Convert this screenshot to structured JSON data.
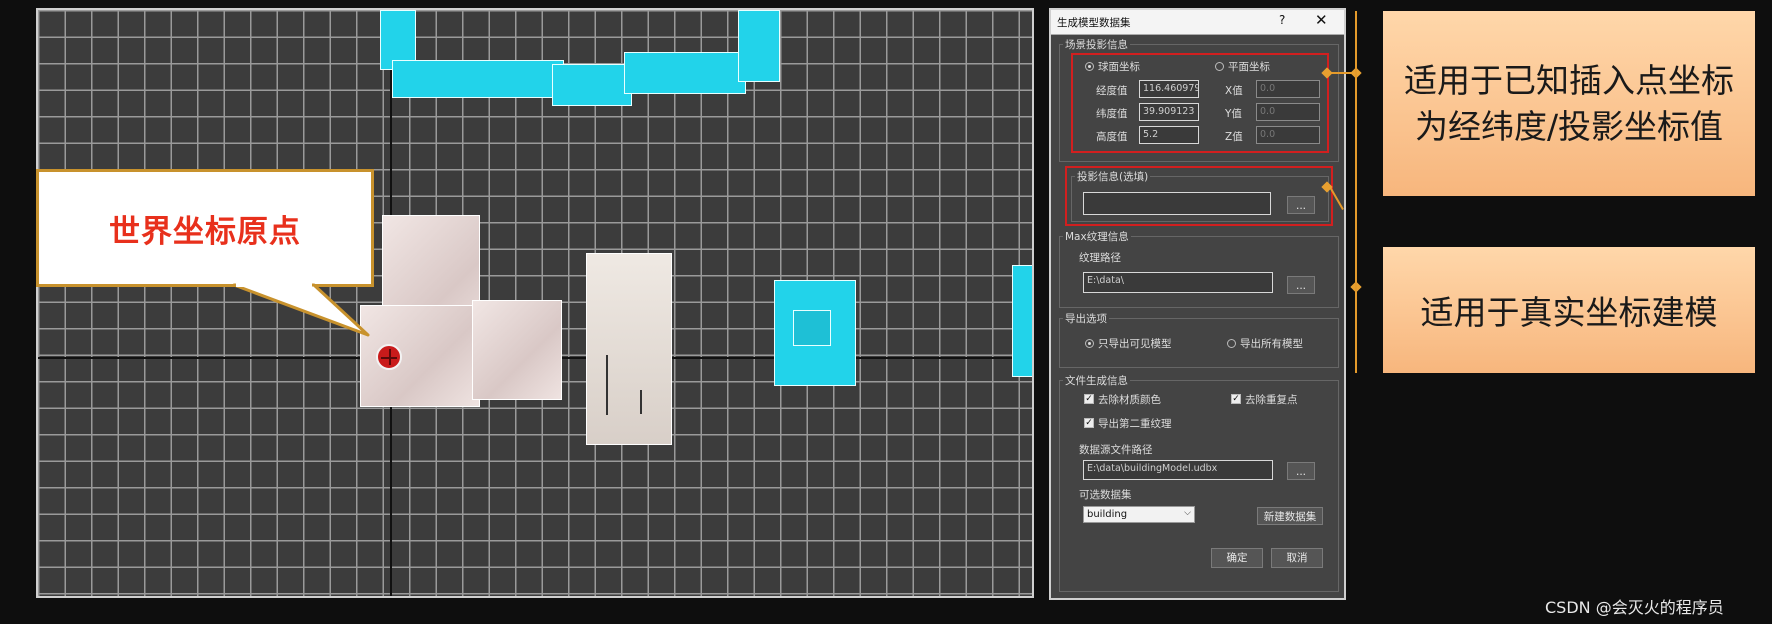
{
  "callout": {
    "text": "世界坐标原点"
  },
  "dialog": {
    "title": "生成模型数据集",
    "help": "?",
    "close": "✕",
    "scene_group": {
      "label": "场景投影信息",
      "radio_sphere": "球面坐标",
      "radio_plane": "平面坐标",
      "lon_label": "经度值",
      "lon_value": "116.460979",
      "lat_label": "纬度值",
      "lat_value": "39.909123",
      "alt_label": "高度值",
      "alt_value": "5.2",
      "x_label": "X值",
      "x_value": "0.0",
      "y_label": "Y值",
      "y_value": "0.0",
      "z_label": "Z值",
      "z_value": "0.0"
    },
    "projection_group": {
      "label": "投影信息(选填)",
      "value": "",
      "browse": "..."
    },
    "texture_group": {
      "label": "Max纹理信息",
      "path_label": "纹理路径",
      "path_value": "E:\\data\\",
      "browse": "..."
    },
    "export_group": {
      "label": "导出选项",
      "visible_only": "只导出可见模型",
      "export_all": "导出所有模型"
    },
    "file_group": {
      "label": "文件生成信息",
      "remove_color": "去除材质颜色",
      "remove_dup": "去除重复点",
      "export_second": "导出第二重纹理",
      "source_label": "数据源文件路径",
      "source_value": "E:\\data\\buildingModel.udbx",
      "browse": "...",
      "dataset_label": "可选数据集",
      "dataset_value": "building",
      "new_dataset": "新建数据集"
    },
    "ok": "确定",
    "cancel": "取消"
  },
  "annotations": {
    "panel1": "适用于已知插入点坐标为经纬度/投影坐标值",
    "panel2": "适用于真实坐标建模"
  },
  "watermark": "CSDN @会灭火的程序员",
  "colors": {
    "cyan": "#22d3ea",
    "red": "#d21f1f",
    "orange": "#e49a2b",
    "panel": "#f9c08a"
  }
}
